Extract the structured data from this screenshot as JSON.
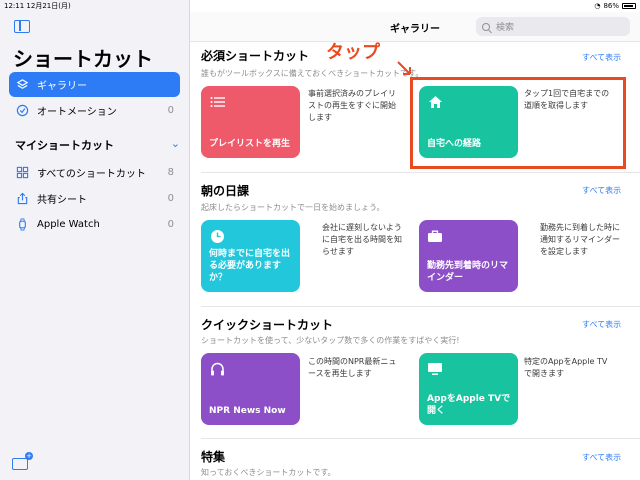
{
  "status": {
    "time": "12:11",
    "date": "12月21日(月)",
    "battery": "86%"
  },
  "sidebar": {
    "title": "ショートカット",
    "items": [
      {
        "label": "ギャラリー",
        "count": ""
      },
      {
        "label": "オートメーション",
        "count": "0"
      }
    ],
    "my_section": "マイショートカット",
    "my_items": [
      {
        "label": "すべてのショートカット",
        "count": "8"
      },
      {
        "label": "共有シート",
        "count": "0"
      },
      {
        "label": "Apple Watch",
        "count": "0"
      }
    ]
  },
  "header": {
    "title": "ギャラリー",
    "search_placeholder": "検索"
  },
  "sections": [
    {
      "title": "必須ショートカット",
      "subtitle": "誰もがツールボックスに備えておくべきショートカットです。",
      "see_all": "すべて表示",
      "cards": [
        {
          "label": "プレイリストを再生",
          "desc": "事前選択済みのプレイリストの再生をすぐに開始します",
          "color": "#ef5a6a"
        },
        {
          "label": "自宅への経路",
          "desc": "タップ1回で自宅までの道順を取得します",
          "color": "#18c4a0"
        }
      ]
    },
    {
      "title": "朝の日課",
      "subtitle": "起床したらショートカットで一日を始めましょう。",
      "see_all": "すべて表示",
      "cards": [
        {
          "label": "何時までに自宅を出る必要がありますか？",
          "desc": "会社に遅刻しないように自宅を出る時間を知らせます",
          "color": "#22c7dc"
        },
        {
          "label": "勤務先到着時のリマインダー",
          "desc": "勤務先に到着した時に通知するリマインダーを設定します",
          "color": "#8d4fc8"
        }
      ]
    },
    {
      "title": "クイックショートカット",
      "subtitle": "ショートカットを使って、少ないタップ数で多くの作業をすばやく実行!",
      "see_all": "すべて表示",
      "cards": [
        {
          "label": "NPR News Now",
          "desc": "この時間のNPR最新ニュースを再生します",
          "color": "#8d4fc8"
        },
        {
          "label": "AppをApple TVで開く",
          "desc": "特定のAppをApple TVで開きます",
          "color": "#18c4a0"
        }
      ]
    },
    {
      "title": "特集",
      "subtitle": "知っておくべきショートカットです。",
      "see_all": "すべて表示",
      "cards": []
    }
  ],
  "annotation": {
    "text": "タップ",
    "color": "#ea4a1f"
  },
  "colors": {
    "accent": "#2d7cf6"
  }
}
